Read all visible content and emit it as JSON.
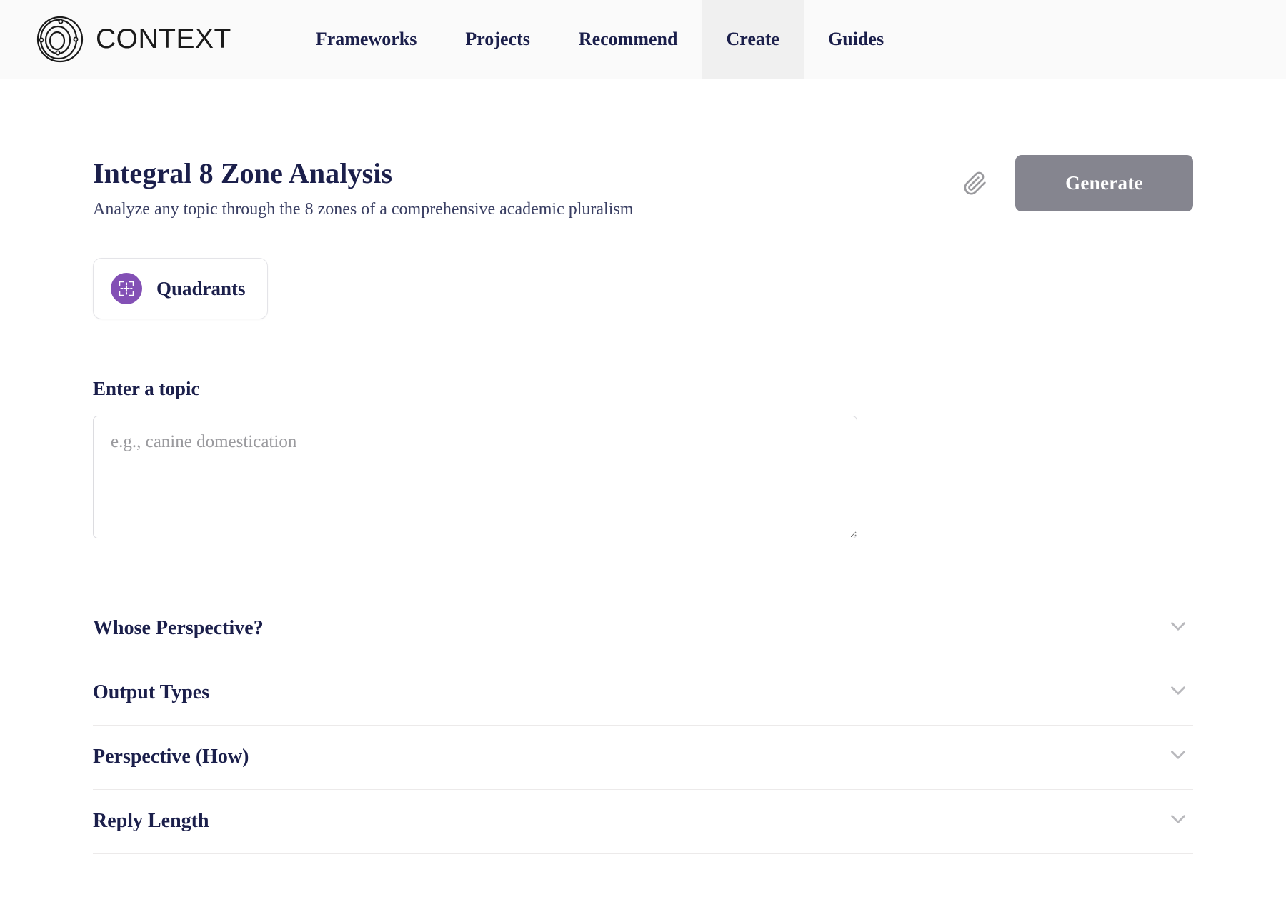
{
  "header": {
    "brand_name": "CONTEXT",
    "logo_icon": "orbital-rings-logo",
    "nav": [
      {
        "label": "Frameworks",
        "active": false
      },
      {
        "label": "Projects",
        "active": false
      },
      {
        "label": "Recommend",
        "active": false
      },
      {
        "label": "Create",
        "active": true
      },
      {
        "label": "Guides",
        "active": false
      }
    ]
  },
  "main": {
    "title": "Integral 8 Zone Analysis",
    "subtitle": "Analyze any topic through the 8 zones of a comprehensive academic pluralism",
    "attach_icon": "paperclip-icon",
    "generate_label": "Generate",
    "framework_chip": {
      "label": "Quadrants",
      "icon": "quadrants-icon",
      "icon_color": "#8350b5"
    },
    "topic_field": {
      "label": "Enter a topic",
      "placeholder": "e.g., canine domestication",
      "value": ""
    },
    "accordions": [
      {
        "title": "Whose Perspective?",
        "icon": "chevron-down-icon",
        "expanded": false
      },
      {
        "title": "Output Types",
        "icon": "chevron-down-icon",
        "expanded": false
      },
      {
        "title": "Perspective (How)",
        "icon": "chevron-down-icon",
        "expanded": false
      },
      {
        "title": "Reply Length",
        "icon": "chevron-down-icon",
        "expanded": false
      }
    ]
  },
  "colors": {
    "navy": "#1b1f4b",
    "accent_purple": "#8350b5",
    "generate_bg": "#85858f",
    "header_bg": "#fafafa",
    "active_tab_bg": "#f0f0f0"
  }
}
